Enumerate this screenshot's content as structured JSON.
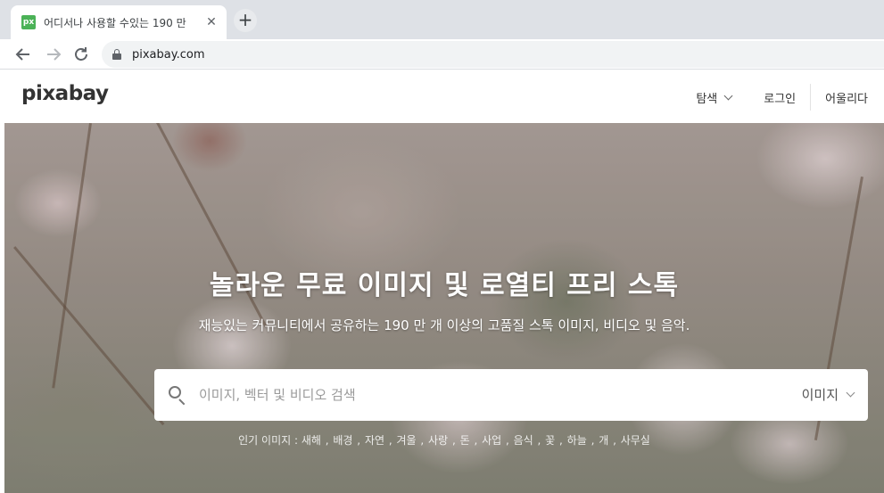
{
  "browser": {
    "tab_title": "어디서나 사용할 수있는 190 만",
    "favicon_text": "px",
    "tab_close": "✕",
    "new_tab": "+",
    "url": "pixabay.com"
  },
  "header": {
    "logo": "pixabay",
    "nav": {
      "explore": "탐색",
      "login": "로그인",
      "join": "어울리다"
    }
  },
  "hero": {
    "title": "놀라운 무료 이미지 및 로열티 프리 스톡",
    "subtitle": "재능있는 커뮤니티에서 공유하는 190 만 개 이상의 고품질 스톡 이미지, 비디오 및 음악.",
    "search": {
      "placeholder": "이미지, 벡터 및 비디오 검색",
      "type": "이미지"
    },
    "popular": {
      "label": "인기 이미지 :",
      "tags": [
        "새해",
        "배경",
        "자연",
        "겨울",
        "사랑",
        "돈",
        "사업",
        "음식",
        "꽃",
        "하늘",
        "개",
        "사무실"
      ]
    }
  },
  "colors": {
    "favicon_bg": "#4bb257",
    "tabstrip_bg": "#dee1e6"
  }
}
